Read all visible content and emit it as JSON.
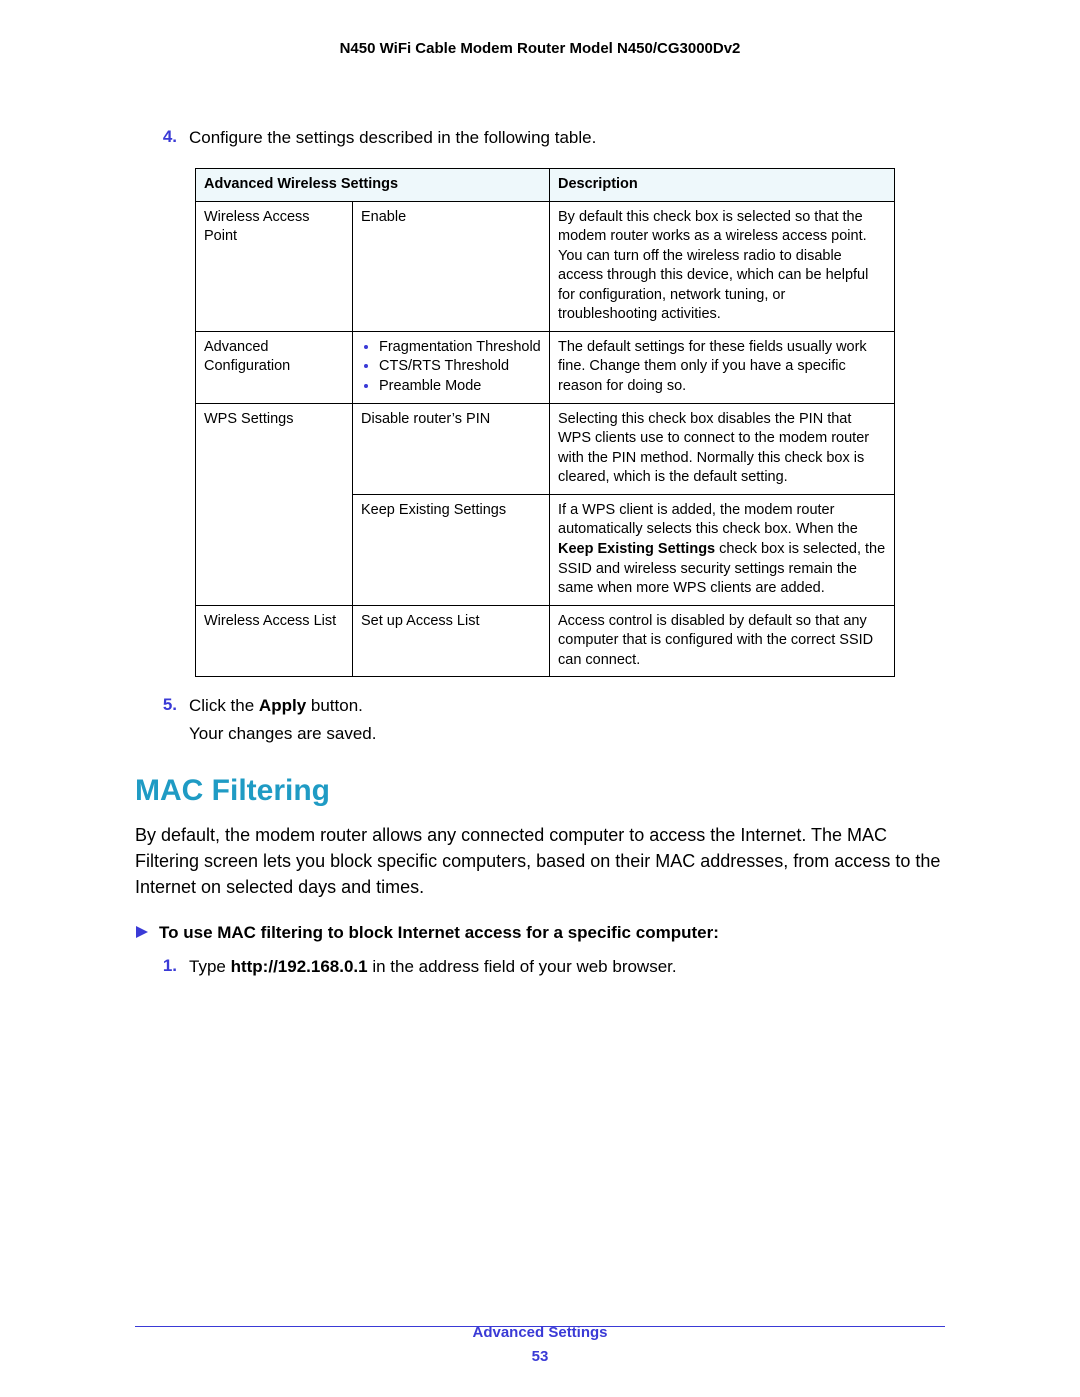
{
  "header": {
    "title": "N450 WiFi Cable Modem Router Model N450/CG3000Dv2"
  },
  "steps": {
    "s4": {
      "num": "4.",
      "text": "Configure the settings described in the following table."
    },
    "s5": {
      "num": "5.",
      "prefix": "Click the ",
      "bold": "Apply",
      "suffix": " button.",
      "after": "Your changes are saved."
    }
  },
  "table": {
    "head": {
      "c1": "Advanced Wireless Settings",
      "c2": "Description"
    },
    "r1": {
      "a": "Wireless Access Point",
      "b": "Enable",
      "c": "By default this check box is selected so that the modem router works as a wireless access point. You can turn off the wireless radio to disable access through this device, which can be helpful for configuration, network tuning, or troubleshooting activities."
    },
    "r2": {
      "a": "Advanced Configuration",
      "b1": "Fragmentation Threshold",
      "b2": "CTS/RTS Threshold",
      "b3": "Preamble Mode",
      "c": "The default settings for these fields usually work fine. Change them only if you have a specific reason for doing so."
    },
    "r3": {
      "a": "WPS Settings",
      "b": "Disable router’s PIN",
      "c": "Selecting this check box disables the PIN that WPS clients use to connect to the modem router with the PIN method. Normally this check box is cleared, which is the default setting."
    },
    "r4": {
      "b": "Keep Existing Settings",
      "c_pre": "If a WPS client is added, the modem router automatically selects this check box. When the ",
      "c_bold": "Keep Existing Settings",
      "c_post": " check box is selected, the SSID and wireless security settings remain the same when more WPS clients are added."
    },
    "r5": {
      "a": "Wireless Access List",
      "b": "Set up Access List",
      "c": "Access control is disabled by default so that any computer that is configured with the correct SSID can connect."
    }
  },
  "section": {
    "heading": "MAC Filtering",
    "intro": "By default, the modem router allows any connected computer to access the Internet. The MAC Filtering screen lets you block specific computers, based on their MAC addresses, from access to the Internet on selected days and times.",
    "proc_title": "To use MAC filtering to block Internet access for a specific computer:",
    "step1": {
      "num": "1.",
      "pre": "Type ",
      "bold": "http://192.168.0.1",
      "post": " in the address field of your web browser."
    }
  },
  "footer": {
    "section": "Advanced Settings",
    "page": "53"
  }
}
